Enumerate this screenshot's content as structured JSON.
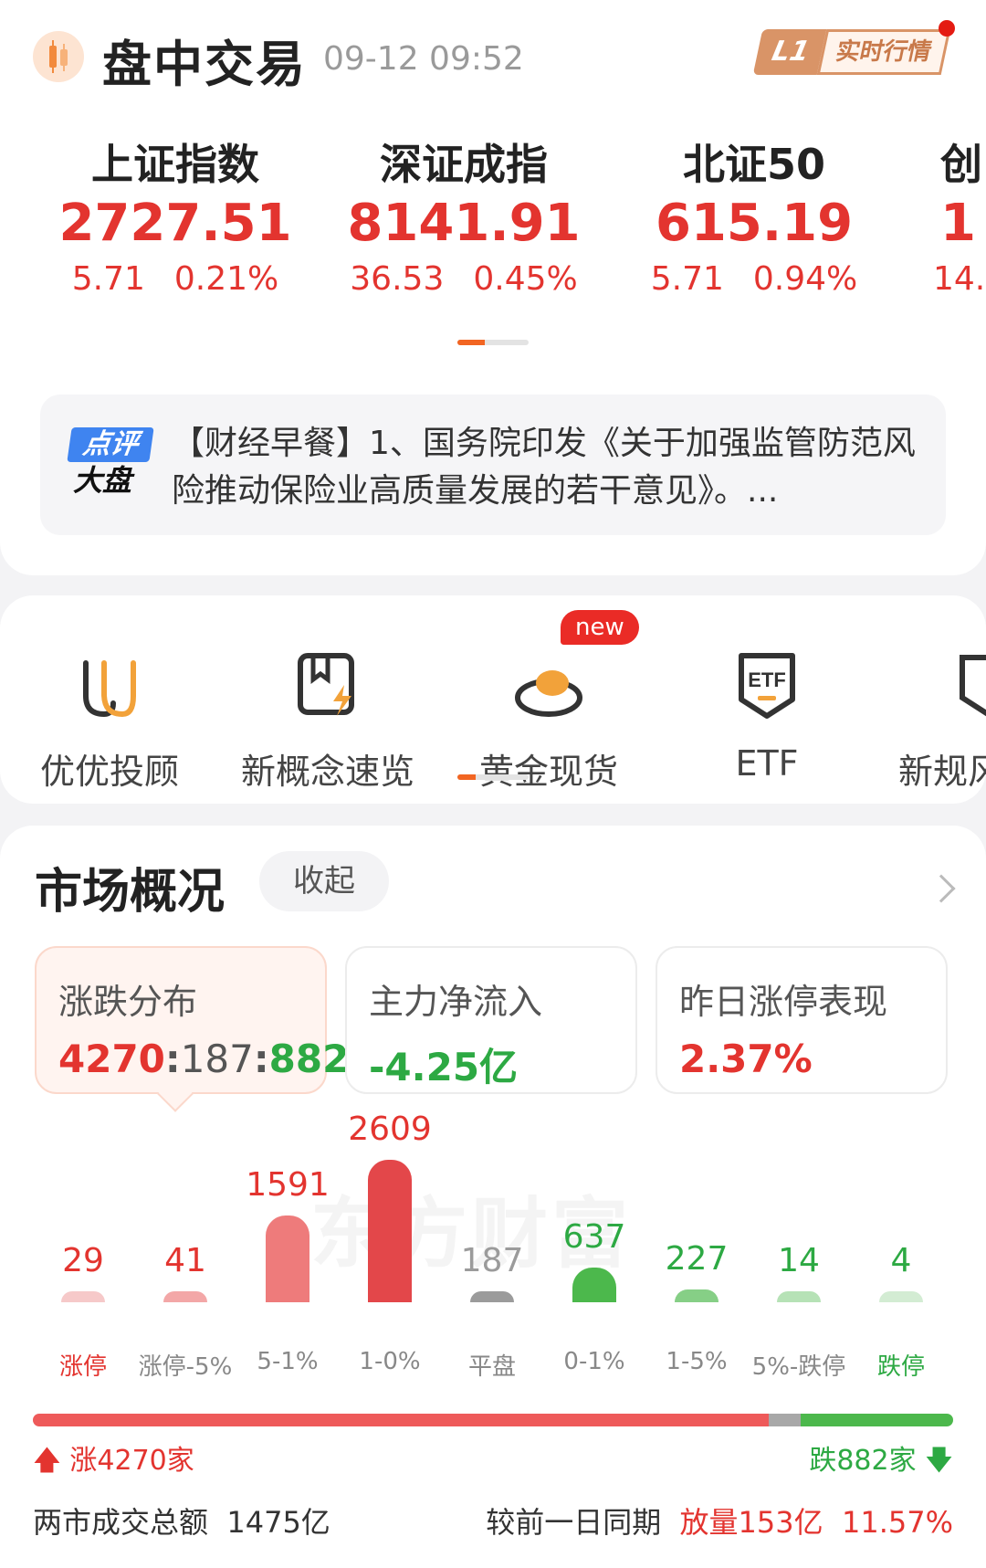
{
  "header": {
    "title": "盘中交易",
    "time": "09-12 09:52",
    "badge_l1": "L1",
    "badge_text": "实时行情"
  },
  "indices": [
    {
      "name": "上证指数",
      "value": "2727.51",
      "change": "5.71",
      "pct": "0.21%"
    },
    {
      "name": "深证成指",
      "value": "8141.91",
      "change": "36.53",
      "pct": "0.45%"
    },
    {
      "name": "北证50",
      "value": "615.19",
      "change": "5.71",
      "pct": "0.94%"
    },
    {
      "name": "创",
      "value": "1",
      "change": "14.",
      "pct": ""
    }
  ],
  "news": {
    "tag_top": "点评",
    "tag_bottom": "大盘",
    "text": "【财经早餐】1、国务院印发《关于加强监管防范风险推动保险业高质量发展的若干意见》。..."
  },
  "shortcuts": [
    {
      "label": "优优投顾",
      "icon": "uu-advisor-icon"
    },
    {
      "label": "新概念速览",
      "icon": "bookmark-lightning-icon"
    },
    {
      "label": "黄金现货",
      "icon": "gold-ingot-icon",
      "badge": "new"
    },
    {
      "label": "ETF",
      "icon": "etf-shield-icon"
    },
    {
      "label": "新规风",
      "icon": "shield-lightning-icon"
    }
  ],
  "market": {
    "title": "市场概况",
    "collapse_label": "收起",
    "stats": [
      {
        "label": "涨跌分布",
        "up": "4270",
        "sep1": ":",
        "flat": "187",
        "sep2": ":",
        "down": "882"
      },
      {
        "label": "主力净流入",
        "value": "-4.25亿"
      },
      {
        "label": "昨日涨停表现",
        "value": "2.37%"
      }
    ],
    "watermark": "东方财富",
    "up_label": "涨4270家",
    "down_label": "跌882家",
    "total_label": "两市成交总额",
    "total_value": "1475亿",
    "compare_label": "较前一日同期",
    "compare_value": "放量153亿",
    "compare_pct": "11.57%"
  },
  "chart_data": {
    "type": "bar",
    "categories": [
      "涨停",
      "涨停-5%",
      "5-1%",
      "1-0%",
      "平盘",
      "0-1%",
      "1-5%",
      "5%-跌停",
      "跌停"
    ],
    "values": [
      29,
      41,
      1591,
      2609,
      187,
      637,
      227,
      14,
      4
    ],
    "colors": [
      "#f6c9c9",
      "#f3a7a7",
      "#ee7b7b",
      "#e3474a",
      "#9b9b9b",
      "#4cb84c",
      "#86cf86",
      "#b6e2b6",
      "#d3ecd3"
    ],
    "label_colors": [
      "#e3342f",
      "#e3342f",
      "#e3342f",
      "#e3342f",
      "#9b9b9b",
      "#2da943",
      "#2da943",
      "#2da943",
      "#2da943"
    ],
    "cat_colors": [
      "#e3342f",
      "#888888",
      "#888888",
      "#888888",
      "#888888",
      "#888888",
      "#888888",
      "#888888",
      "#2da943"
    ],
    "ratio": {
      "up": 4270,
      "flat": 187,
      "down": 882
    }
  }
}
